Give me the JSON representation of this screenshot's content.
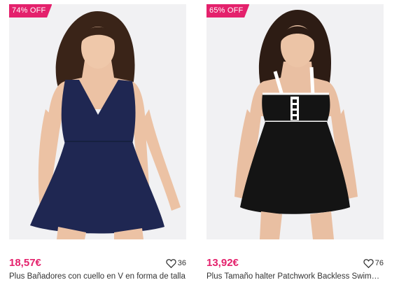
{
  "products": [
    {
      "discount_badge": "74% OFF",
      "price": "18,57€",
      "likes": "36",
      "title": "Plus Bañadores con cuello en V en forma de talla",
      "swimsuit_color": "#1f2752",
      "icon": "heart-outline-icon"
    },
    {
      "discount_badge": "65% OFF",
      "price": "13,92€",
      "likes": "76",
      "title": "Plus Tamaño halter Patchwork Backless Swimdress",
      "swimsuit_color": "#141414",
      "icon": "heart-outline-icon"
    }
  ],
  "colors": {
    "accent": "#e4216c",
    "photo_background": "#f1f1f3",
    "text": "#333333"
  }
}
